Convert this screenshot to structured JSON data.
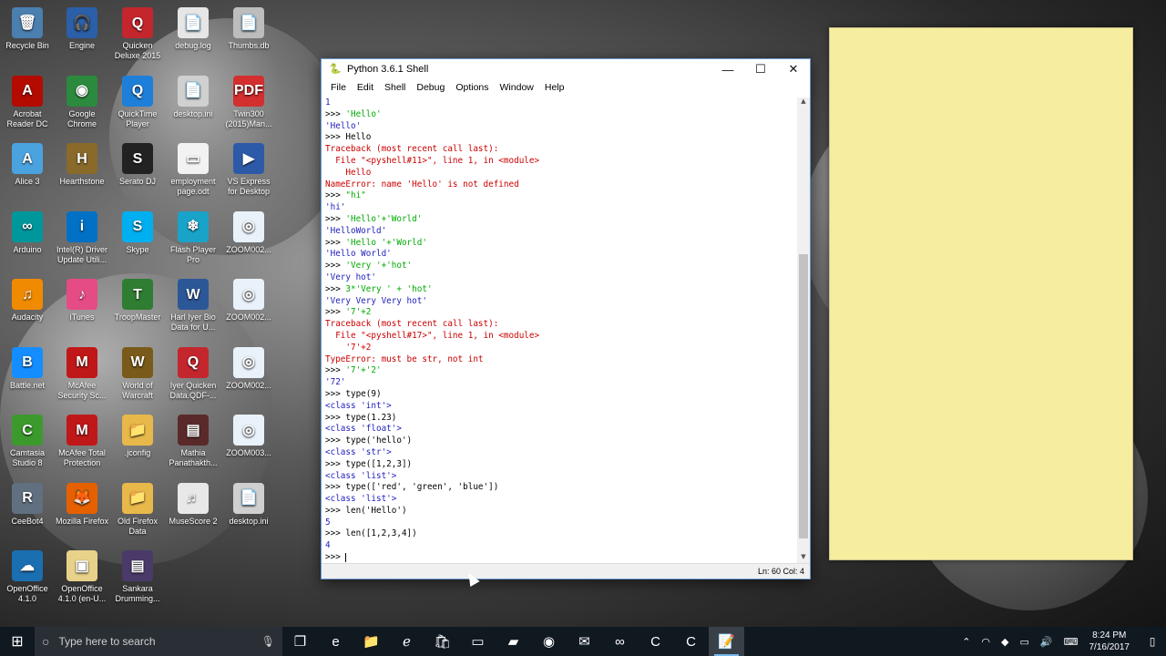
{
  "colors": {
    "sticky": "#f7ed9f",
    "taskbar": "#101820",
    "str": "#00aa00",
    "err": "#cc0000",
    "out": "#1d1dbd"
  },
  "desktop": {
    "icons": [
      {
        "label": "Recycle Bin",
        "icon": "recycle-bin-icon",
        "color": "#4a7fb0",
        "glyph": "🗑"
      },
      {
        "label": "Engine",
        "icon": "engine-icon",
        "color": "#2b5fa8",
        "glyph": "🎧"
      },
      {
        "label": "Quicken Deluxe 2015",
        "icon": "quicken-icon",
        "color": "#c4262e",
        "glyph": "Q"
      },
      {
        "label": "debug.log",
        "icon": "file-icon",
        "color": "#e6e6e6",
        "glyph": "📄"
      },
      {
        "label": "Thumbs.db",
        "icon": "file-icon",
        "color": "#bdbdbd",
        "glyph": "📄"
      },
      {
        "label": "Acrobat Reader DC",
        "icon": "acrobat-icon",
        "color": "#b30b00",
        "glyph": "A"
      },
      {
        "label": "Google Chrome",
        "icon": "chrome-icon",
        "color": "#2b8a3e",
        "glyph": "◉"
      },
      {
        "label": "QuickTime Player",
        "icon": "quicktime-icon",
        "color": "#1e7fd8",
        "glyph": "Q"
      },
      {
        "label": "desktop.ini",
        "icon": "file-icon",
        "color": "#d0d0d0",
        "glyph": "📄"
      },
      {
        "label": "Twin300 (2015)Man...",
        "icon": "pdf-icon",
        "color": "#d32f2f",
        "glyph": "PDF"
      },
      {
        "label": "Alice 3",
        "icon": "alice-icon",
        "color": "#4aa3df",
        "glyph": "A"
      },
      {
        "label": "Hearthstone",
        "icon": "hearthstone-icon",
        "color": "#8a6a2a",
        "glyph": "H"
      },
      {
        "label": "Serato DJ",
        "icon": "serato-icon",
        "color": "#222222",
        "glyph": "S"
      },
      {
        "label": "employment page.odt",
        "icon": "document-icon",
        "color": "#f2f2f2",
        "glyph": "▭"
      },
      {
        "label": "VS Express for Desktop",
        "icon": "visual-studio-icon",
        "color": "#2d5aa8",
        "glyph": "▶"
      },
      {
        "label": "Arduino",
        "icon": "arduino-icon",
        "color": "#00979c",
        "glyph": "∞"
      },
      {
        "label": "Intel(R) Driver Update Utili...",
        "icon": "intel-icon",
        "color": "#0071c5",
        "glyph": "i"
      },
      {
        "label": "Skype",
        "icon": "skype-icon",
        "color": "#00aff0",
        "glyph": "S"
      },
      {
        "label": "Flash Player Pro",
        "icon": "flash-player-icon",
        "color": "#1aa3c8",
        "glyph": "❄"
      },
      {
        "label": "ZOOM002...",
        "icon": "zoom-file-icon",
        "color": "#e9f2fb",
        "glyph": "◎"
      },
      {
        "label": "Audacity",
        "icon": "audacity-icon",
        "color": "#f08a00",
        "glyph": "♫"
      },
      {
        "label": "iTunes",
        "icon": "itunes-icon",
        "color": "#e54b85",
        "glyph": "♪"
      },
      {
        "label": "TroopMaster",
        "icon": "troopmaster-icon",
        "color": "#2e7d32",
        "glyph": "T"
      },
      {
        "label": "Harl Iyer Bio Data for U...",
        "icon": "word-doc-icon",
        "color": "#2b5797",
        "glyph": "W"
      },
      {
        "label": "ZOOM002...",
        "icon": "zoom-file-icon",
        "color": "#e9f2fb",
        "glyph": "◎"
      },
      {
        "label": "Battle.net",
        "icon": "battlenet-icon",
        "color": "#148eff",
        "glyph": "B"
      },
      {
        "label": "McAfee Security Sc...",
        "icon": "mcafee-icon",
        "color": "#c01818",
        "glyph": "M"
      },
      {
        "label": "World of Warcraft",
        "icon": "warcraft-icon",
        "color": "#7a5a1a",
        "glyph": "W"
      },
      {
        "label": "Iyer Quicken Data.QDF-...",
        "icon": "quicken-file-icon",
        "color": "#c4262e",
        "glyph": "Q"
      },
      {
        "label": "ZOOM002...",
        "icon": "zoom-file-icon",
        "color": "#e9f2fb",
        "glyph": "◎"
      },
      {
        "label": "Camtasia Studio 8",
        "icon": "camtasia-icon",
        "color": "#3c9a2d",
        "glyph": "C"
      },
      {
        "label": "McAfee Total Protection",
        "icon": "mcafee-icon",
        "color": "#c01818",
        "glyph": "M"
      },
      {
        "label": ".jconfig",
        "icon": "folder-icon",
        "color": "#e8b84a",
        "glyph": "📁"
      },
      {
        "label": "Mathia Panathakth...",
        "icon": "media-file-icon",
        "color": "#5a2a2a",
        "glyph": "▤"
      },
      {
        "label": "ZOOM003...",
        "icon": "zoom-file-icon",
        "color": "#e9f2fb",
        "glyph": "◎"
      },
      {
        "label": "CeeBot4",
        "icon": "ceebot-icon",
        "color": "#607080",
        "glyph": "R"
      },
      {
        "label": "Mozilla Firefox",
        "icon": "firefox-icon",
        "color": "#e66000",
        "glyph": "🦊"
      },
      {
        "label": "Old Firefox Data",
        "icon": "folder-icon",
        "color": "#e8b84a",
        "glyph": "📁"
      },
      {
        "label": "MuseScore 2",
        "icon": "musescore-icon",
        "color": "#e8e8e8",
        "glyph": "♬"
      },
      {
        "label": "desktop.ini",
        "icon": "file-icon",
        "color": "#d0d0d0",
        "glyph": "📄"
      },
      {
        "label": "OpenOffice 4.1.0",
        "icon": "openoffice-icon",
        "color": "#1a6fb0",
        "glyph": "☁"
      },
      {
        "label": "OpenOffice 4.1.0 (en-U...",
        "icon": "openoffice-installer-icon",
        "color": "#e8d28a",
        "glyph": "▣"
      },
      {
        "label": "Sankara Drumming...",
        "icon": "media-file-icon",
        "color": "#4a3a6a",
        "glyph": "▤"
      }
    ]
  },
  "shell": {
    "title": "Python 3.6.1 Shell",
    "menu": [
      "File",
      "Edit",
      "Shell",
      "Debug",
      "Options",
      "Window",
      "Help"
    ],
    "status": "Ln: 60   Col: 4",
    "lines": [
      {
        "t": "1",
        "c": "out"
      },
      {
        "p": ">>> ",
        "t": "'Hello'",
        "c": "str"
      },
      {
        "t": "'Hello'",
        "c": "out"
      },
      {
        "p": ">>> ",
        "t": "Hello",
        "c": "prompt"
      },
      {
        "t": "Traceback (most recent call last):",
        "c": "err"
      },
      {
        "t": "  File \"<pyshell#11>\", line 1, in <module>",
        "c": "err"
      },
      {
        "t": "    Hello",
        "c": "err"
      },
      {
        "t": "NameError: name 'Hello' is not defined",
        "c": "err"
      },
      {
        "p": ">>> ",
        "t": "\"hi\"",
        "c": "str"
      },
      {
        "t": "'hi'",
        "c": "out"
      },
      {
        "p": ">>> ",
        "t": "'Hello'+'World'",
        "c": "str"
      },
      {
        "t": "'HelloWorld'",
        "c": "out"
      },
      {
        "p": ">>> ",
        "t": "'Hello '+'World'",
        "c": "str"
      },
      {
        "t": "'Hello World'",
        "c": "out"
      },
      {
        "p": ">>> ",
        "t": "'Very '+'hot'",
        "c": "str"
      },
      {
        "t": "'Very hot'",
        "c": "out"
      },
      {
        "p": ">>> ",
        "t": "3*'Very ' + 'hot'",
        "c": "str"
      },
      {
        "t": "'Very Very Very hot'",
        "c": "out"
      },
      {
        "p": ">>> ",
        "t": "'7'+2",
        "c": "str"
      },
      {
        "t": "Traceback (most recent call last):",
        "c": "err"
      },
      {
        "t": "  File \"<pyshell#17>\", line 1, in <module>",
        "c": "err"
      },
      {
        "t": "    '7'+2",
        "c": "err"
      },
      {
        "t": "TypeError: must be str, not int",
        "c": "err"
      },
      {
        "p": ">>> ",
        "t": "'7'+'2'",
        "c": "str"
      },
      {
        "t": "'72'",
        "c": "out"
      },
      {
        "p": ">>> ",
        "t": "type(9)",
        "c": "prompt"
      },
      {
        "t": "<class 'int'>",
        "c": "out"
      },
      {
        "p": ">>> ",
        "t": "type(1.23)",
        "c": "prompt"
      },
      {
        "t": "<class 'float'>",
        "c": "out"
      },
      {
        "p": ">>> ",
        "t": "type('hello')",
        "c": "prompt"
      },
      {
        "t": "<class 'str'>",
        "c": "out"
      },
      {
        "p": ">>> ",
        "t": "type([1,2,3])",
        "c": "prompt"
      },
      {
        "t": "<class 'list'>",
        "c": "out"
      },
      {
        "p": ">>> ",
        "t": "type(['red', 'green', 'blue'])",
        "c": "prompt"
      },
      {
        "t": "<class 'list'>",
        "c": "out"
      },
      {
        "p": ">>> ",
        "t": "len('Hello')",
        "c": "prompt"
      },
      {
        "t": "5",
        "c": "out"
      },
      {
        "p": ">>> ",
        "t": "len([1,2,3,4])",
        "c": "prompt"
      },
      {
        "t": "4",
        "c": "out"
      },
      {
        "p": ">>> ",
        "t": "",
        "c": "prompt",
        "caret": true
      }
    ]
  },
  "taskbar": {
    "search_placeholder": "Type here to search",
    "apps": [
      {
        "icon": "task-view-icon",
        "glyph": "❐"
      },
      {
        "icon": "edge-icon",
        "glyph": "e"
      },
      {
        "icon": "file-explorer-icon",
        "glyph": "📁"
      },
      {
        "icon": "internet-explorer-icon",
        "glyph": "ℯ"
      },
      {
        "icon": "store-icon",
        "glyph": "🛍"
      },
      {
        "icon": "monitor-icon",
        "glyph": "▭"
      },
      {
        "icon": "sticky-notes-icon",
        "glyph": "▰"
      },
      {
        "icon": "firefox-icon",
        "glyph": "◉"
      },
      {
        "icon": "mail-icon",
        "glyph": "✉"
      },
      {
        "icon": "visual-studio-icon",
        "glyph": "∞"
      },
      {
        "icon": "camtasia-icon",
        "glyph": "C"
      },
      {
        "icon": "camtasia-recorder-icon",
        "glyph": "C"
      },
      {
        "icon": "python-idle-icon",
        "glyph": "📝",
        "active": true
      }
    ],
    "tray": [
      "chevron-up-icon",
      "wifi-icon",
      "mcafee-tray-icon",
      "battery-icon",
      "volume-icon",
      "keyboard-icon"
    ],
    "time": "8:24 PM",
    "date": "7/16/2017"
  }
}
